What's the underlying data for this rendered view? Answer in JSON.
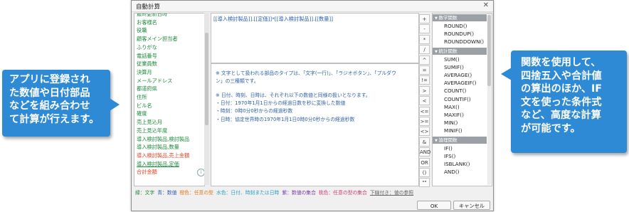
{
  "callouts": {
    "left": "アプリに登録され\nた数値や日付部品\nなどを組み合わせ\nて計算が行えます。",
    "right": "関数を使用して、\n四捨五入や合計値\nの算出のほか、IF\n文を使った条件式\nなど、高度な計算\nが可能です。",
    "color": "#2f8ad6"
  },
  "dialog": {
    "title": "自動計算",
    "close_icon": "close-icon"
  },
  "fields": [
    {
      "label": "最終更新日時",
      "color": "#1a8a3a"
    },
    {
      "label": "お客様名",
      "color": "#1a8a3a"
    },
    {
      "label": "役職",
      "color": "#1a8a3a"
    },
    {
      "label": "顧客メイン担当者",
      "color": "#1a8a3a"
    },
    {
      "label": "ふりがな",
      "color": "#1a8a3a"
    },
    {
      "label": "電話番号",
      "color": "#1a8a3a"
    },
    {
      "label": "従業員数",
      "color": "#1a8a3a"
    },
    {
      "label": "決算月",
      "color": "#1a8a3a"
    },
    {
      "label": "メールアドレス",
      "color": "#1a8a3a"
    },
    {
      "label": "都道府県",
      "color": "#1a8a3a"
    },
    {
      "label": "住所",
      "color": "#1a8a3a"
    },
    {
      "label": "ビル名",
      "color": "#1a8a3a"
    },
    {
      "label": "確度",
      "color": "#1a8a3a"
    },
    {
      "label": "売上見込月",
      "color": "#1a8a3a"
    },
    {
      "label": "売上見込年度",
      "color": "#1a8a3a"
    },
    {
      "label": "導入検討製品,検討製品",
      "color": "#1a8a3a"
    },
    {
      "label": "導入検討製品,数量",
      "color": "#1a8a3a"
    },
    {
      "label": "導入検討製品,売上金額",
      "color": "#e0452a"
    },
    {
      "label": "導入検討製品,定価",
      "color": "#1a8a3a",
      "underline": true
    },
    {
      "label": "合計金額",
      "color": "#e0452a"
    }
  ],
  "editor": {
    "formula": "[[導入検討製品]].[[定価]]*[[導入検討製品]].[[数量]]"
  },
  "description": {
    "lines": [
      "※ 文字として扱われる部品のタイプは、「文字(一行)」、「ラジオボタン」、「プルダウ",
      "   ン」の三種類です。",
      "",
      "※ 日付、時刻、日時は、それぞれ以下の数値と同様の扱いとなります。",
      "   ・日付：1970年1月1日からの経過日数を秒に変換した数値",
      "   ・時刻：0時0分0秒からの経過秒数",
      "   ・日時：協定世界時の1970年1月1日0時0分0秒からの経過秒数"
    ]
  },
  "operators": [
    "+",
    "-",
    "*",
    "/",
    "^",
    "=",
    "!=",
    ">",
    "<",
    "<=",
    ">=",
    "<>",
    "&",
    "AND",
    "OR",
    "()",
    "\"\""
  ],
  "functions": {
    "groups": [
      {
        "name": "数学関数",
        "items": [
          "ROUND()",
          "ROUNDUP()",
          "ROUNDDOWN()"
        ]
      },
      {
        "name": "統計関数",
        "items": [
          "SUM()",
          "SUMIF()",
          "AVERAGE()",
          "AVERAGEIF()",
          "COUNT()",
          "COUNTIF()",
          "MAX()",
          "MAXIF()",
          "MIN()",
          "MINIF()"
        ]
      },
      {
        "name": "論理関数",
        "items": [
          "IF()",
          "IFS()",
          "ISBLANK()",
          "AND()"
        ]
      }
    ],
    "collapse_icon": "triangle-down-icon"
  },
  "legend": {
    "items": [
      {
        "text": "緑：文字",
        "color": "#1a8a3a"
      },
      {
        "text": "青：数値",
        "color": "#2a5fb0"
      },
      {
        "text": "橙色：任意の型",
        "color": "#e07b1a"
      },
      {
        "text": "水色：日付、時刻または日時",
        "color": "#2aa0c8"
      },
      {
        "text": "紫：数値の集合",
        "color": "#7a3aa8"
      },
      {
        "text": "桃色：任意の型の集合",
        "color": "#d0407a"
      },
      {
        "text": "下線付き：値の参照",
        "color": "#666666",
        "underline": true
      }
    ]
  },
  "buttons": {
    "ok": "OK",
    "cancel": "キャンセル"
  }
}
